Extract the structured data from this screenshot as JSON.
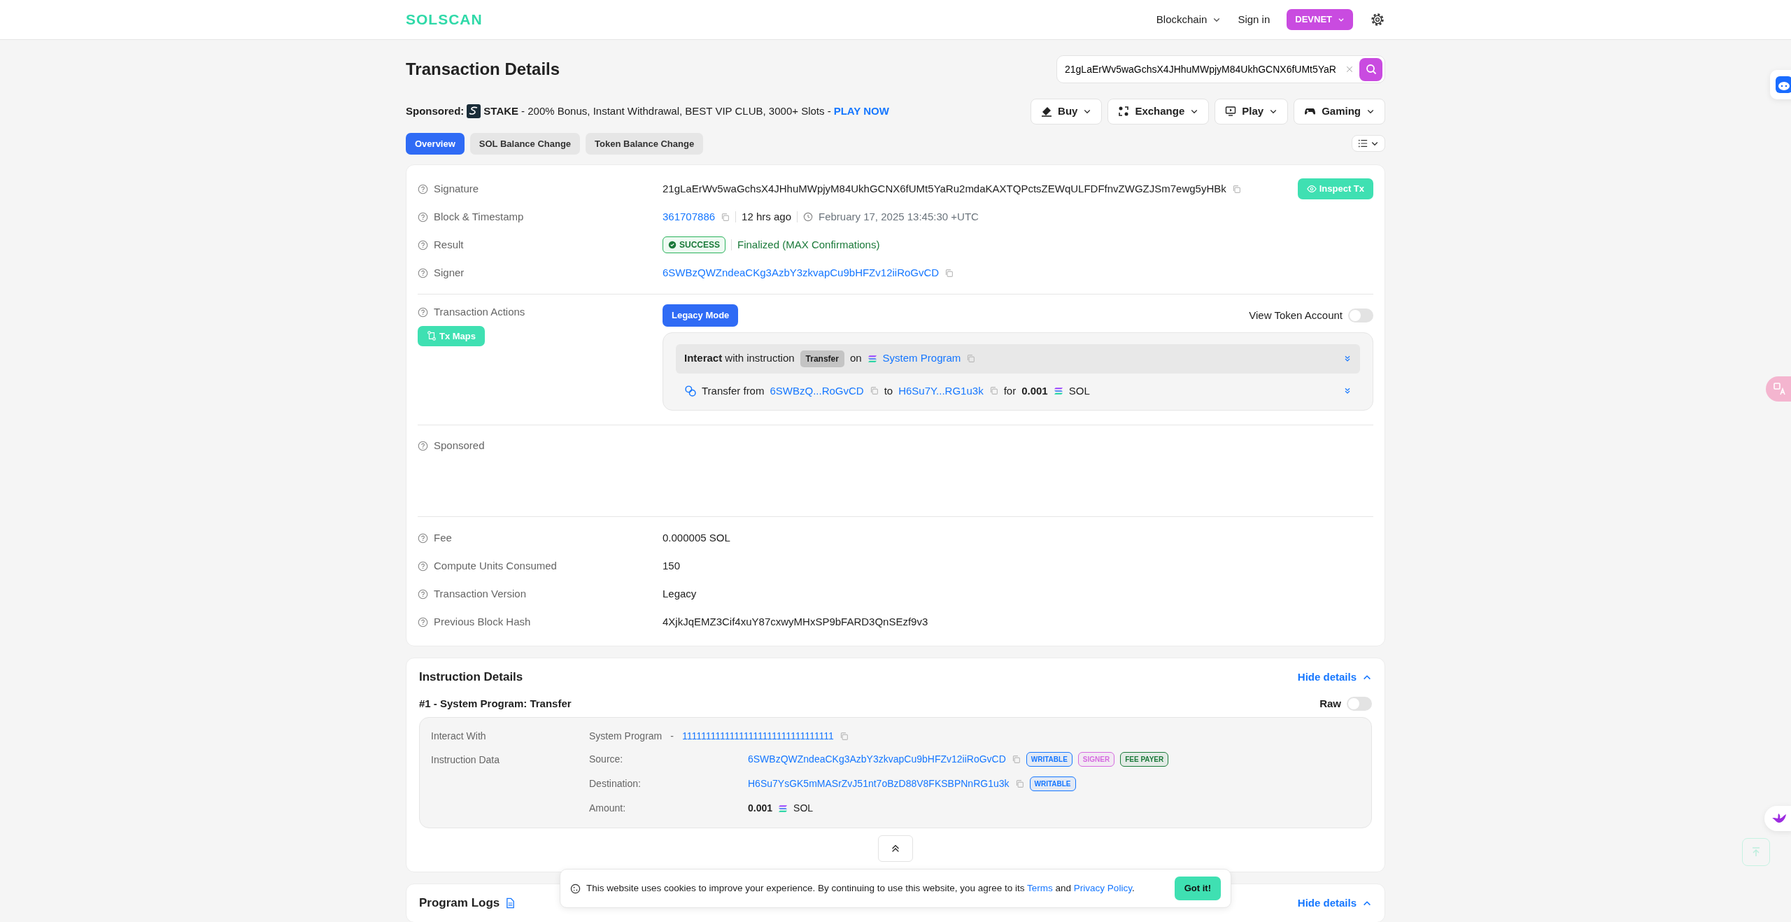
{
  "header": {
    "logo": "SOLSCAN",
    "nav": [
      {
        "label": "Blockchain",
        "dropdown": true
      },
      {
        "label": "Sign in",
        "dropdown": false
      }
    ],
    "network": "DEVNET"
  },
  "title": "Transaction Details",
  "search": {
    "value": "21gLaErWv5waGchsX4JHhuMWpjyM84UkhGCNX6fUMt5YaR"
  },
  "sponsored": {
    "label": "Sponsored:",
    "brand": "STAKE",
    "text": "- 200% Bonus, Instant Withdrawal, BEST VIP CLUB, 3000+ Slots -",
    "cta": "PLAY NOW"
  },
  "menus": [
    {
      "label": "Buy"
    },
    {
      "label": "Exchange"
    },
    {
      "label": "Play"
    },
    {
      "label": "Gaming"
    }
  ],
  "tabs": [
    {
      "label": "Overview",
      "selected": true
    },
    {
      "label": "SOL Balance Change",
      "selected": false
    },
    {
      "label": "Token Balance Change",
      "selected": false
    }
  ],
  "overview": {
    "sections": [
      [
        {
          "kind": "text",
          "label": "Signature",
          "value": "21gLaErWv5waGchsX4JHhuMWpjyM84UkhGCNX6fUMt5YaRu2mdaKAXTQPctsZEWqULFDFfnvZWGZJSm7ewg5yHBk",
          "action": "Inspect Tx"
        },
        {
          "kind": "block",
          "label": "Block & Timestamp",
          "block": "361707886",
          "age": "12 hrs ago",
          "time": "February 17, 2025 13:45:30 +UTC"
        },
        {
          "kind": "result",
          "label": "Result",
          "status": "SUCCESS",
          "note": "Finalized (MAX Confirmations)"
        },
        {
          "kind": "link",
          "label": "Signer",
          "value": "6SWBzQWZndeaCKg3AzbY3zkvapCu9bHFZv12iiRoGvCD"
        }
      ],
      [
        {
          "kind": "actions",
          "label": "Transaction Actions",
          "button": "Tx Maps",
          "mode": "Legacy Mode",
          "toggle": {
            "label": "View Token Account",
            "on": false
          },
          "instruction": {
            "text": "**Interact** with instruction",
            "badge": "Transfer",
            "on": "on",
            "program": "System Program"
          },
          "transfer": {
            "text": "Transfer from",
            "from": "6SWBzQ...RoGvCD",
            "to_word": "to",
            "to": "H6Su7Y...RG1u3k",
            "for_word": "for",
            "amount": "0.001",
            "token": "SOL"
          }
        }
      ],
      [
        {
          "kind": "empty",
          "label": "Sponsored"
        }
      ],
      [
        {
          "kind": "plain",
          "label": "Fee",
          "value": "0.000005 SOL"
        },
        {
          "kind": "plain",
          "label": "Compute Units Consumed",
          "value": "150"
        },
        {
          "kind": "plain",
          "label": "Transaction Version",
          "value": "Legacy"
        },
        {
          "kind": "plain",
          "label": "Previous Block Hash",
          "value": "4XjkJqEMZ3Cif4xuY87cxwyMHxSP9bFARD3QnSEzf9v3"
        }
      ]
    ]
  },
  "instruction_details": {
    "title": "Instruction Details",
    "hide": "Hide details",
    "expanded": true,
    "heading": "#1 - System Program: Transfer",
    "raw": {
      "label": "Raw",
      "on": false
    },
    "interact": {
      "label": "Interact With",
      "program": "System Program",
      "sep": "-",
      "address": "11111111111111111111111111111111"
    },
    "data": {
      "label": "Instruction Data",
      "fields": [
        {
          "kind": "account",
          "label": "Source:",
          "value": "6SWBzQWZndeaCKg3AzbY3zkvapCu9bHFZv12iiRoGvCD",
          "tags": [
            {
              "text": "WRITABLE",
              "color": "#1677ff"
            },
            {
              "text": "SIGNER",
              "color": "#d66be0"
            },
            {
              "text": "FEE PAYER",
              "color": "#1b7a3a"
            }
          ]
        },
        {
          "kind": "account",
          "label": "Destination:",
          "value": "H6Su7YsGK5mMASrZvJ51nt7oBzD88V8FKSBPNnRG1u3k",
          "tags": [
            {
              "text": "WRITABLE",
              "color": "#1677ff"
            }
          ]
        },
        {
          "kind": "amount",
          "label": "Amount:",
          "value": "0.001",
          "token": "SOL"
        }
      ]
    }
  },
  "program_logs": {
    "title": "Program Logs",
    "hide": "Hide details",
    "expanded": true
  },
  "cookie": {
    "text": "This website uses cookies to improve your experience. By continuing to use this website, you agree to its",
    "terms": "Terms",
    "and": "and",
    "privacy": "Privacy Policy",
    "end": ".",
    "button": "Got it!"
  }
}
